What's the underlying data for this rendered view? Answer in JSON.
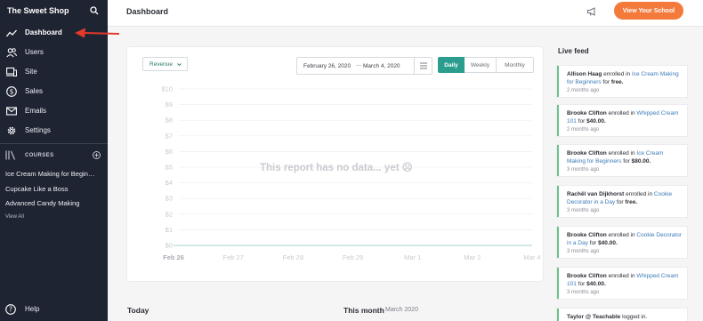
{
  "sidebar": {
    "brand": "The Sweet Shop",
    "nav": [
      {
        "label": "Dashboard",
        "icon": "trend-line-icon",
        "active": true
      },
      {
        "label": "Users",
        "icon": "users-icon"
      },
      {
        "label": "Site",
        "icon": "devices-icon"
      },
      {
        "label": "Sales",
        "icon": "dollar-icon"
      },
      {
        "label": "Emails",
        "icon": "envelope-icon"
      },
      {
        "label": "Settings",
        "icon": "gear-icon"
      }
    ],
    "courses_label": "COURSES",
    "courses": [
      "Ice Cream Making for Begin…",
      "Cupcake Like a Boss",
      "Advanced Candy Making"
    ],
    "view_all": "View All",
    "help": "Help"
  },
  "header": {
    "title": "Dashboard",
    "view_school": "View Your School"
  },
  "report": {
    "metric": "Revenue",
    "date_start": "February 26, 2020",
    "date_sep": "—",
    "date_end": "March 4, 2020",
    "tabs": [
      "Daily",
      "Weekly",
      "Monthly"
    ],
    "active_tab": "Daily",
    "no_data": "This report has no data... yet ☹"
  },
  "chart_data": {
    "type": "line",
    "categories": [
      "Feb 26",
      "Feb 27",
      "Feb 28",
      "Feb 29",
      "Mar 1",
      "Mar 2",
      "Mar 4"
    ],
    "y_ticks": [
      "$10",
      "$9",
      "$8",
      "$7",
      "$6",
      "$5",
      "$4",
      "$3",
      "$2",
      "$1",
      "$0"
    ],
    "ylim": [
      0,
      10
    ],
    "series": [
      {
        "values": [
          0,
          0,
          0,
          0,
          0,
          0,
          0
        ]
      }
    ],
    "grid": true,
    "colors": {
      "line": "#c4e4df",
      "grid": "#eeeff1",
      "tick": "#c9cbd0"
    }
  },
  "live_feed": {
    "title": "Live feed",
    "items": [
      {
        "name": "Allison Haag",
        "verb": " enrolled in ",
        "course": "Ice Cream Making for Beginners",
        "for": " for ",
        "amount": "free.",
        "ago": "2 months ago"
      },
      {
        "name": "Brooke Clifton",
        "verb": " enrolled in ",
        "course": "Whipped Cream 101",
        "for": " for ",
        "amount": "$40.00.",
        "ago": "2 months ago"
      },
      {
        "name": "Brooke Clifton",
        "verb": " enrolled in ",
        "course": "Ice Cream Making for Beginners",
        "for": " for ",
        "amount": "$80.00.",
        "ago": "3 months ago"
      },
      {
        "name": "Rachël van Dijkhorst",
        "verb": " enrolled in ",
        "course": "Cookie Decorator in a Day",
        "for": " for ",
        "amount": "free.",
        "ago": "3 months ago"
      },
      {
        "name": "Brooke Clifton",
        "verb": " enrolled in ",
        "course": "Cookie Decorator in a Day",
        "for": " for ",
        "amount": "$40.00.",
        "ago": "3 months ago"
      },
      {
        "name": "Brooke Clifton",
        "verb": " enrolled in ",
        "course": "Whipped Cream 101",
        "for": " for ",
        "amount": "$40.00.",
        "ago": "3 months ago"
      },
      {
        "name": "Taylor @ Teachable",
        "verb": " logged in.",
        "course": "",
        "for": "",
        "amount": "",
        "ago": ""
      }
    ]
  },
  "summary": {
    "today": "Today",
    "this_month": "This month",
    "this_month_date": "March 2020"
  },
  "colors": {
    "sidebar_bg": "#1f2433",
    "accent_orange": "#f47a3c",
    "accent_teal": "#2a9d8f",
    "feed_border": "#6cc28a",
    "arrow": "#e5392b"
  }
}
